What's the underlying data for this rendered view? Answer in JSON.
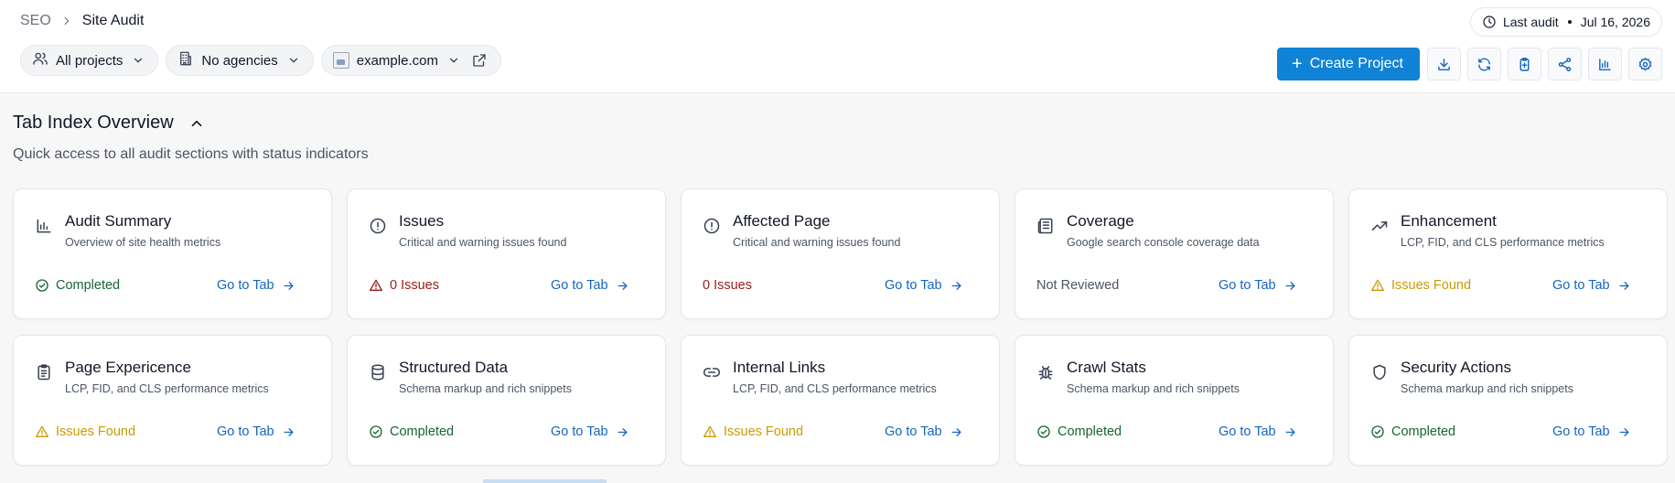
{
  "breadcrumb": {
    "parent": "SEO",
    "current": "Site Audit"
  },
  "filters": {
    "projects": "All projects",
    "agencies": "No agencies",
    "domain": "example.com"
  },
  "last_audit": {
    "label": "Last audit",
    "date": "Jul 16, 2026"
  },
  "toolbar": {
    "create_label": "Create Project",
    "icons": [
      "download-icon",
      "refresh-icon",
      "clipboard-icon",
      "share-icon",
      "bar-chart-icon",
      "settings-icon"
    ]
  },
  "section": {
    "title": "Tab Index Overview",
    "subtitle": "Quick access to all audit sections with status indicators"
  },
  "goto_label": "Go to Tab",
  "colors": {
    "primary": "#1183d6",
    "ok": "#166534",
    "warn": "#ca9a04",
    "bad": "#991b1b",
    "link": "#1565c0"
  },
  "cards": [
    {
      "title": "Audit Summary",
      "desc": "Overview of site health metrics",
      "status": "Completed",
      "status_type": "ok",
      "icon": "bar-chart-icon"
    },
    {
      "title": "Issues",
      "desc": "Critical and warning issues found",
      "status": "0 Issues",
      "status_type": "bad-icon",
      "icon": "alert-circle-icon"
    },
    {
      "title": "Affected Page",
      "desc": "Critical and warning issues found",
      "status": "0 Issues",
      "status_type": "bad",
      "icon": "alert-circle-icon"
    },
    {
      "title": "Coverage",
      "desc": "Google search console coverage data",
      "status": "Not Reviewed",
      "status_type": "none",
      "icon": "newspaper-icon"
    },
    {
      "title": "Enhancement",
      "desc": "LCP, FID, and CLS performance metrics",
      "status": "Issues Found",
      "status_type": "warn",
      "icon": "trending-up-icon"
    },
    {
      "title": "Page Expericence",
      "desc": "LCP, FID, and CLS performance metrics",
      "status": "Issues Found",
      "status_type": "warn",
      "icon": "clipboard-list-icon"
    },
    {
      "title": "Structured Data",
      "desc": "Schema markup and rich snippets",
      "status": "Completed",
      "status_type": "ok",
      "icon": "database-icon"
    },
    {
      "title": "Internal Links",
      "desc": "LCP, FID, and CLS performance metrics",
      "status": "Issues Found",
      "status_type": "warn",
      "icon": "link-icon"
    },
    {
      "title": "Crawl Stats",
      "desc": "Schema markup and rich snippets",
      "status": "Completed",
      "status_type": "ok",
      "icon": "bug-icon"
    },
    {
      "title": "Security Actions",
      "desc": "Schema markup and rich snippets",
      "status": "Completed",
      "status_type": "ok",
      "icon": "shield-icon"
    }
  ]
}
